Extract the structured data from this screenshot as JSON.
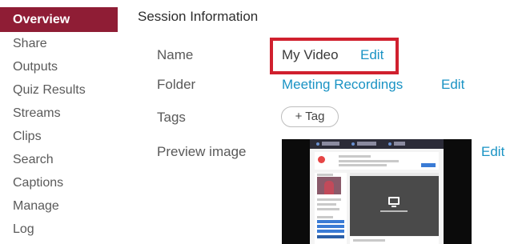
{
  "sidebar": {
    "items": [
      {
        "label": "Overview",
        "active": true
      },
      {
        "label": "Share"
      },
      {
        "label": "Outputs"
      },
      {
        "label": "Quiz Results"
      },
      {
        "label": "Streams"
      },
      {
        "label": "Clips"
      },
      {
        "label": "Search"
      },
      {
        "label": "Captions"
      },
      {
        "label": "Manage"
      },
      {
        "label": "Log"
      }
    ]
  },
  "main": {
    "section_title": "Session Information",
    "name": {
      "label": "Name",
      "value": "My Video",
      "edit_label": "Edit"
    },
    "folder": {
      "label": "Folder",
      "value": "Meeting Recordings",
      "edit_label": "Edit"
    },
    "tags": {
      "label": "Tags",
      "add_label": "+ Tag"
    },
    "preview": {
      "label": "Preview image",
      "edit_label": "Edit"
    }
  },
  "colors": {
    "accent": "#8f1d35",
    "link": "#1a93c4",
    "highlight": "#d0202e"
  }
}
